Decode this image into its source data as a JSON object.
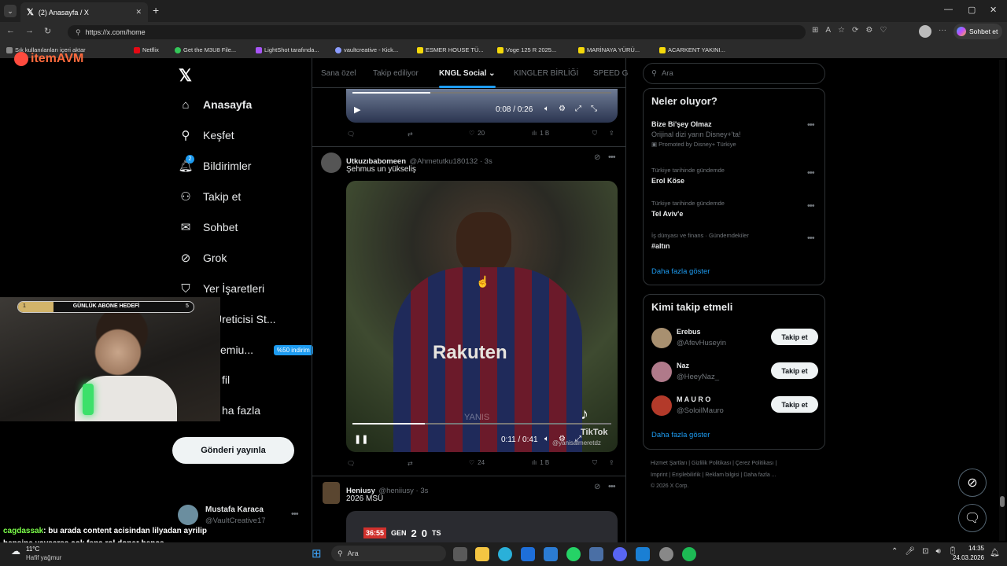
{
  "browser": {
    "tab_title": "(2) Anasayfa / X",
    "url": "https://x.com/home",
    "copilot_label": "Sohbet et",
    "bookmarks": [
      "Sık kullanılanları içeri aktar",
      "Netflix",
      "Get the M3U8 File...",
      "LightShot tarafında...",
      "vaultcreative - Kick...",
      "ESMER HOUSE TÜ...",
      "Voge 125 R 2025...",
      "MARİNAYA YÜRÜ...",
      "ACARKENT YAKINI..."
    ]
  },
  "overlay": {
    "logo_text": "itemAVM",
    "goal_label": "GÜNLÜK ABONE HEDEFİ",
    "goal_current": "1",
    "goal_target": "5",
    "goal_progress": 0.2,
    "chat_user": "cagdassak",
    "chat_message": ": bu arada content acisindan lilyadan ayrilip hepsine yavsarsa cok fena rol doner bence"
  },
  "nav": {
    "home": "Anasayfa",
    "explore": "Keşfet",
    "notifications": "Bildirimler",
    "follow": "Takip et",
    "chat": "Sohbet",
    "grok": "Grok",
    "bookmarks": "Yer İşaretleri",
    "creator": "ik Üreticisi St...",
    "premium": "emiu...",
    "premium_badge": "%50 indirim",
    "profile": "fil",
    "more": "ha fazla",
    "post_button": "Gönderi yayınla",
    "notif_count": "2",
    "account_name": "Mustafa Karaca",
    "account_handle": "@VaultCreative17"
  },
  "tabs": [
    "Sana özel",
    "Takip ediliyor",
    "KNGL Social",
    "KINGLER BİRLİĞİ",
    "SPEED G"
  ],
  "tweets": {
    "prev": {
      "time": "0:08 / 0:26",
      "likes": "20",
      "views": "1 B"
    },
    "t1": {
      "name": "Utkuzıbabomeen",
      "handle": "@Ahmetutku180132 · 3s",
      "text": "Şehmus un yükseliş",
      "time": "0:11 / 0:41",
      "likes": "24",
      "views": "1 B",
      "watermark": "TikTok",
      "watermark_user": "@yanisalmeretdz",
      "shirt_text": "Rakuten",
      "yanis": "YANIS"
    },
    "t2": {
      "name": "Heniusy",
      "handle": "@heniiusy · 3s",
      "text": "2026 MSÜ",
      "score_time": "36:55",
      "team1": "GEN",
      "score1": "2",
      "score2": "0",
      "team2": "TS"
    }
  },
  "right": {
    "search_placeholder": "Ara",
    "trends_title": "Neler oluyor?",
    "trends": [
      {
        "meta": "",
        "name": "Bize Bi'şey Olmaz",
        "sub": "Orijinal dizi yarın Disney+'ta!",
        "promo": "Promoted by Disney+ Türkiye"
      },
      {
        "meta": "Türkiye tarihinde gündemde",
        "name": "Erol Köse"
      },
      {
        "meta": "Türkiye tarihinde gündemde",
        "name": "Tel Aviv'e"
      },
      {
        "meta": "İş dünyası ve finans · Gündemdekiler",
        "name": "#altın"
      }
    ],
    "show_more": "Daha fazla göster",
    "who_title": "Kimi takip etmeli",
    "who": [
      {
        "name": "Erebus",
        "handle": "@AfevHuseyin",
        "btn": "Takip et"
      },
      {
        "name": "Naz",
        "handle": "@HeeyNaz_",
        "btn": "Takip et"
      },
      {
        "name": "M A U R O",
        "handle": "@SoloilMauro",
        "btn": "Takip et"
      }
    ],
    "footer1": "Hizmet Şartları  |  Gizlilik Politikası  |  Çerez Politikası  |",
    "footer2": "Imprint  |  Erişilebilirlik  |  Reklam bilgisi  |  Daha fazla ...",
    "footer3": "© 2026 X Corp."
  },
  "taskbar": {
    "weather_temp": "11°C",
    "weather_desc": "Hafif yağmur",
    "search": "Ara",
    "time": "14:35",
    "date": "24.03.2026"
  }
}
